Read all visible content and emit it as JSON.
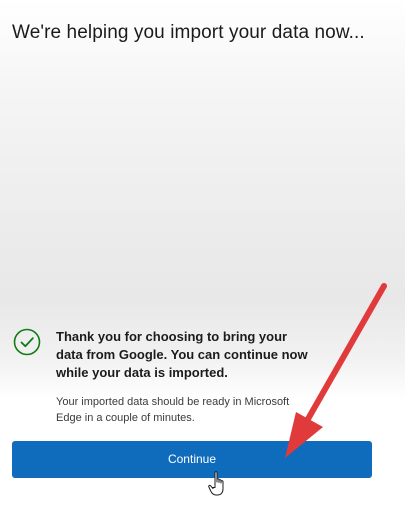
{
  "dialog": {
    "title": "We're helping you import your data now...",
    "message": "Thank you for choosing to bring your data from Google. You can continue now while your data is imported.",
    "note": "Your imported data should be ready in Microsoft Edge in a couple of minutes.",
    "continue_label": "Continue"
  },
  "icons": {
    "status": "check-circle-icon",
    "cursor": "hand-pointer-cursor-icon",
    "annotation": "red-arrow"
  },
  "colors": {
    "accent": "#0f6cbd",
    "success": "#107c10",
    "annotation": "#e03a3a"
  }
}
